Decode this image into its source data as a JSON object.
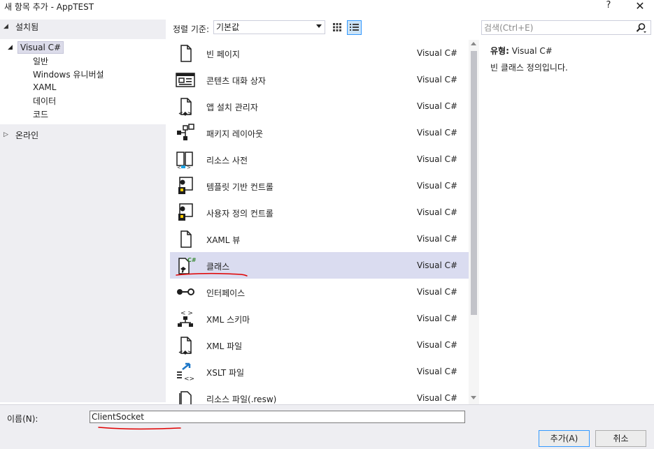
{
  "window": {
    "title": "새 항목 추가 - AppTEST",
    "help": "?",
    "close": "✕"
  },
  "sidebar": {
    "installed": "설치됨",
    "tree_root": "Visual C#",
    "tree_children": [
      "일반",
      "Windows 유니버설",
      "XAML",
      "데이터",
      "코드"
    ],
    "online": "온라인"
  },
  "toolbar": {
    "sort_label": "정렬 기준:",
    "sort_value": "기본값"
  },
  "search": {
    "placeholder": "검색(Ctrl+E)"
  },
  "items": [
    {
      "name": "빈 페이지",
      "lang": "Visual C#",
      "icon": "blank-page-icon"
    },
    {
      "name": "콘텐츠 대화 상자",
      "lang": "Visual C#",
      "icon": "content-dialog-icon"
    },
    {
      "name": "앱 설치 관리자",
      "lang": "Visual C#",
      "icon": "app-installer-icon"
    },
    {
      "name": "패키지 레이아웃",
      "lang": "Visual C#",
      "icon": "package-layout-icon"
    },
    {
      "name": "리소스 사전",
      "lang": "Visual C#",
      "icon": "resource-dictionary-icon"
    },
    {
      "name": "템플릿 기반 컨트롤",
      "lang": "Visual C#",
      "icon": "templated-control-icon"
    },
    {
      "name": "사용자 정의 컨트롤",
      "lang": "Visual C#",
      "icon": "user-control-icon"
    },
    {
      "name": "XAML 뷰",
      "lang": "Visual C#",
      "icon": "xaml-view-icon"
    },
    {
      "name": "클래스",
      "lang": "Visual C#",
      "icon": "class-icon"
    },
    {
      "name": "인터페이스",
      "lang": "Visual C#",
      "icon": "interface-icon"
    },
    {
      "name": "XML 스키마",
      "lang": "Visual C#",
      "icon": "xml-schema-icon"
    },
    {
      "name": "XML 파일",
      "lang": "Visual C#",
      "icon": "xml-file-icon"
    },
    {
      "name": "XSLT 파일",
      "lang": "Visual C#",
      "icon": "xslt-file-icon"
    },
    {
      "name": "리소스 파일(.resw)",
      "lang": "Visual C#",
      "icon": "resource-file-icon"
    }
  ],
  "selected_index": 8,
  "details": {
    "type_label": "유형:",
    "type_value": "Visual C#",
    "description": "빈 클래스 정의입니다."
  },
  "bottom": {
    "name_label": "이름(N):",
    "name_value": "ClientSocket",
    "add_button": "추가(A)",
    "cancel_button": "취소"
  },
  "colors": {
    "selection": "#dadcf0",
    "accent": "#3399ff",
    "annotation": "#e00000"
  }
}
